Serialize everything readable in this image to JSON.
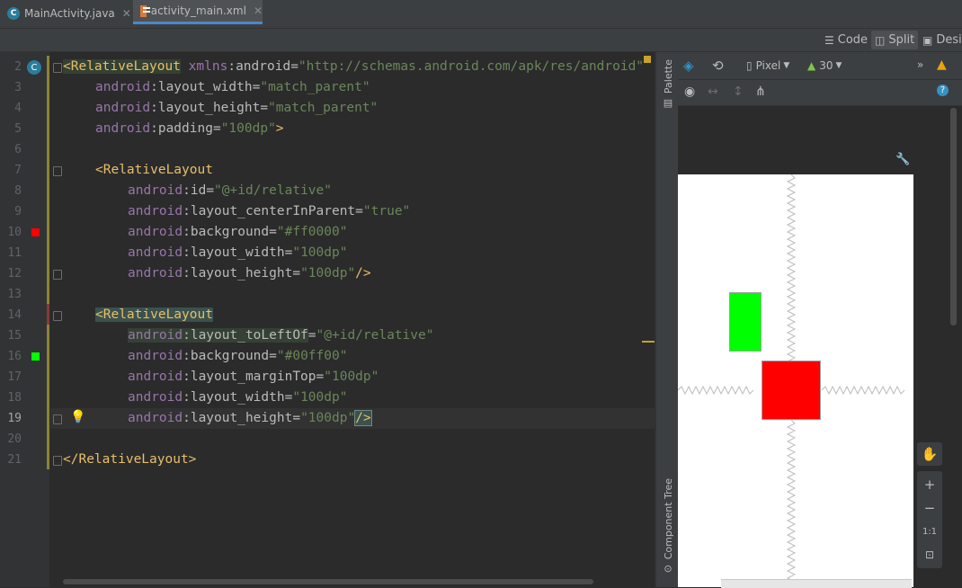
{
  "tabs": [
    {
      "label": "MainActivity.java",
      "icon": "class-icon",
      "badge": "C"
    },
    {
      "label": "activity_main.xml",
      "icon": "xml-file-icon",
      "active": true
    }
  ],
  "toolbar": {
    "code": "Code",
    "split": "Split",
    "design": "Design"
  },
  "editor": {
    "line_numbers": [
      "2",
      "3",
      "4",
      "5",
      "6",
      "7",
      "8",
      "9",
      "10",
      "11",
      "12",
      "13",
      "14",
      "15",
      "16",
      "17",
      "18",
      "19",
      "20",
      "21"
    ],
    "current_line": "19",
    "lines": [
      {
        "tag": "<RelativeLayout",
        "ns": " xmlns",
        "attr": ":android",
        "eq": "=",
        "val": "\"http://schemas.android.com/apk/res/android\""
      },
      {
        "ns": "android",
        "attr": ":layout_width",
        "eq": "=",
        "val": "\"match_parent\""
      },
      {
        "ns": "android",
        "attr": ":layout_height",
        "eq": "=",
        "val": "\"match_parent\""
      },
      {
        "ns": "android",
        "attr": ":padding",
        "eq": "=",
        "val": "\"100dp\"",
        "end": ">"
      },
      {},
      {
        "tag": "<RelativeLayout"
      },
      {
        "ns": "android",
        "attr": ":id",
        "eq": "=",
        "val": "\"@+id/relative\""
      },
      {
        "ns": "android",
        "attr": ":layout_centerInParent",
        "eq": "=",
        "val": "\"true\""
      },
      {
        "ns": "android",
        "attr": ":background",
        "eq": "=",
        "val": "\"#ff0000\""
      },
      {
        "ns": "android",
        "attr": ":layout_width",
        "eq": "=",
        "val": "\"100dp\""
      },
      {
        "ns": "android",
        "attr": ":layout_height",
        "eq": "=",
        "val": "\"100dp\"",
        "end": "/>"
      },
      {},
      {
        "tag": "<RelativeLayout"
      },
      {
        "ns": "android",
        "attr": ":layout_toLeftOf",
        "eq": "=",
        "val": "\"@+id/relative\""
      },
      {
        "ns": "android",
        "attr": ":background",
        "eq": "=",
        "val": "\"#00ff00\""
      },
      {
        "ns": "android",
        "attr": ":layout_marginTop",
        "eq": "=",
        "val": "\"100dp\""
      },
      {
        "ns": "android",
        "attr": ":layout_width",
        "eq": "=",
        "val": "\"100dp\""
      },
      {
        "ns": "android",
        "attr": ":layout_height",
        "eq": "=",
        "val": "\"100dp\"",
        "end": "/>"
      },
      {},
      {
        "tag": "</RelativeLayout>"
      }
    ],
    "gutter_colors": {
      "red": "#ff0000",
      "green": "#00ff00"
    }
  },
  "side_panels": {
    "palette": "Palette",
    "component_tree": "Component Tree"
  },
  "design_toolbar": {
    "device": "Pixel",
    "api": "30",
    "zoom_reset": "1:1"
  },
  "preview": {
    "red_box_color": "#ff0000",
    "green_box_color": "#00ff00",
    "background": "#ffffff"
  },
  "colors": {
    "accent": "#4a88c7",
    "warning": "#e5a50a",
    "help": "#3592c4"
  }
}
